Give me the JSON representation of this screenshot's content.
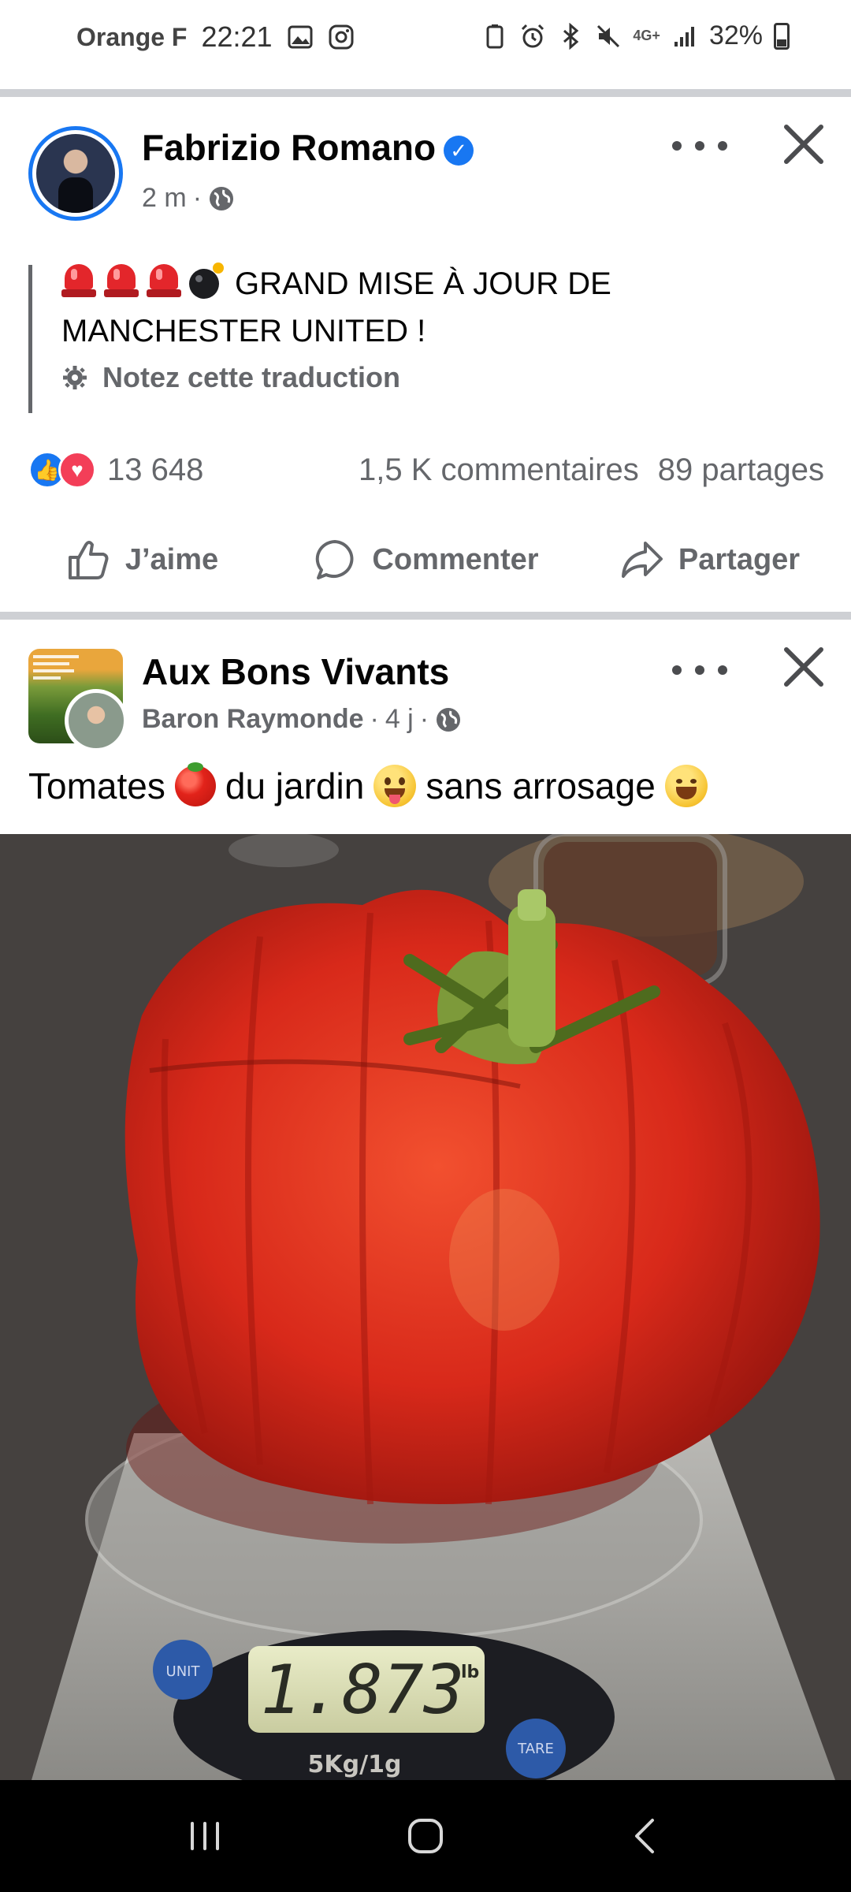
{
  "status_bar": {
    "carrier": "Orange F",
    "time": "22:21",
    "network": "4G+",
    "battery": "32%"
  },
  "post1": {
    "author": "Fabrizio Romano",
    "verified": true,
    "time": "2 m",
    "text": "GRAND MISE À JOUR DE MANCHESTER UNITED !",
    "translate_label": "Notez cette traduction",
    "reaction_count": "13 648",
    "comments": "1,5 K commentaires",
    "shares": "89 partages",
    "actions": {
      "like": "J’aime",
      "comment": "Commenter",
      "share": "Partager"
    }
  },
  "post2": {
    "page": "Aux Bons Vivants",
    "author": "Baron Raymonde",
    "time": "4 j",
    "text_part1": "Tomates",
    "text_part2": "du jardin",
    "text_part3": "sans arrosage",
    "scale_reading": "1.873",
    "scale_unit": "lb",
    "scale_btn_left": "UNIT",
    "scale_btn_right": "TARE",
    "scale_capacity": "5Kg/1g"
  },
  "colors": {
    "brand_blue": "#1877f2",
    "love_red": "#f33e58",
    "secondary_text": "#65676b"
  }
}
